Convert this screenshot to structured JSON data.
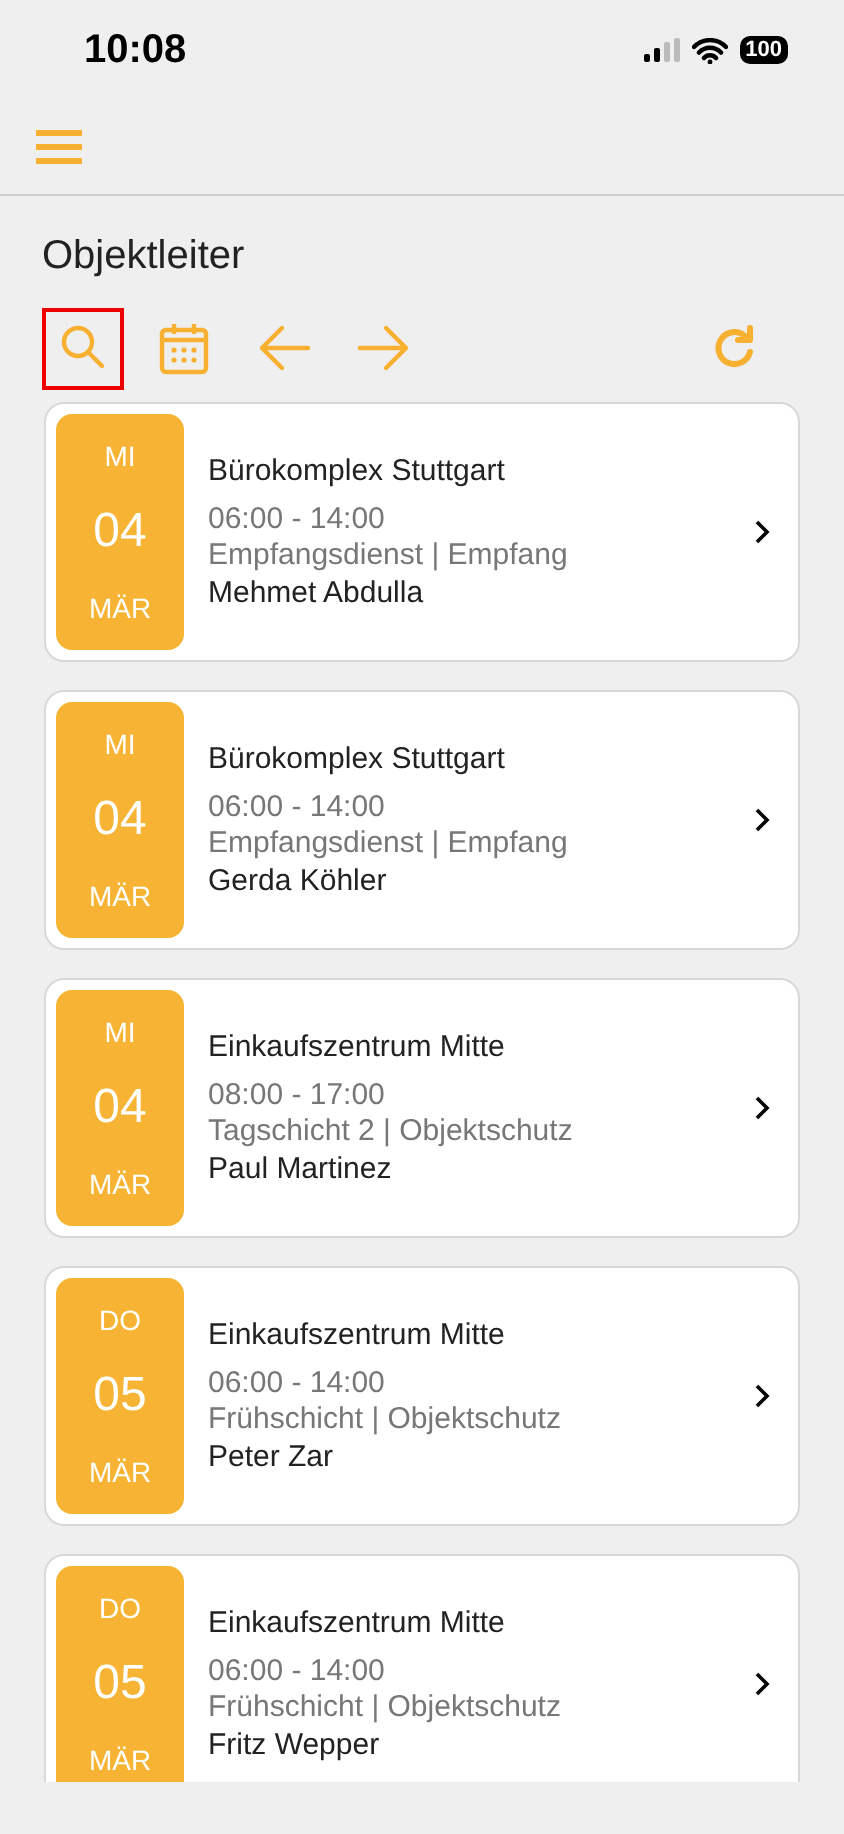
{
  "status_bar": {
    "time": "10:08",
    "battery": "100"
  },
  "page_title": "Objektleiter",
  "toolbar": [
    {
      "kind": "search",
      "highlighted": true
    },
    {
      "kind": "calendar",
      "highlighted": false
    },
    {
      "kind": "back",
      "highlighted": false
    },
    {
      "kind": "forward",
      "highlighted": false
    },
    {
      "kind": "refresh",
      "highlighted": false
    }
  ],
  "shifts": [
    {
      "weekday": "MI",
      "day": "04",
      "month": "MÄR",
      "site": "Bürokomplex Stuttgart",
      "time": "06:00 - 14:00",
      "role": "Empfangsdienst | Empfang",
      "person": "Mehmet Abdulla"
    },
    {
      "weekday": "MI",
      "day": "04",
      "month": "MÄR",
      "site": "Bürokomplex Stuttgart",
      "time": "06:00 - 14:00",
      "role": "Empfangsdienst | Empfang",
      "person": "Gerda Köhler"
    },
    {
      "weekday": "MI",
      "day": "04",
      "month": "MÄR",
      "site": "Einkaufszentrum Mitte",
      "time": "08:00 - 17:00",
      "role": "Tagschicht 2 | Objektschutz",
      "person": "Paul Martinez"
    },
    {
      "weekday": "DO",
      "day": "05",
      "month": "MÄR",
      "site": "Einkaufszentrum Mitte",
      "time": "06:00 - 14:00",
      "role": "Frühschicht | Objektschutz",
      "person": "Peter Zar"
    },
    {
      "weekday": "DO",
      "day": "05",
      "month": "MÄR",
      "site": "Einkaufszentrum Mitte",
      "time": "06:00 - 14:00",
      "role": "Frühschicht | Objektschutz",
      "person": "Fritz Wepper"
    }
  ]
}
